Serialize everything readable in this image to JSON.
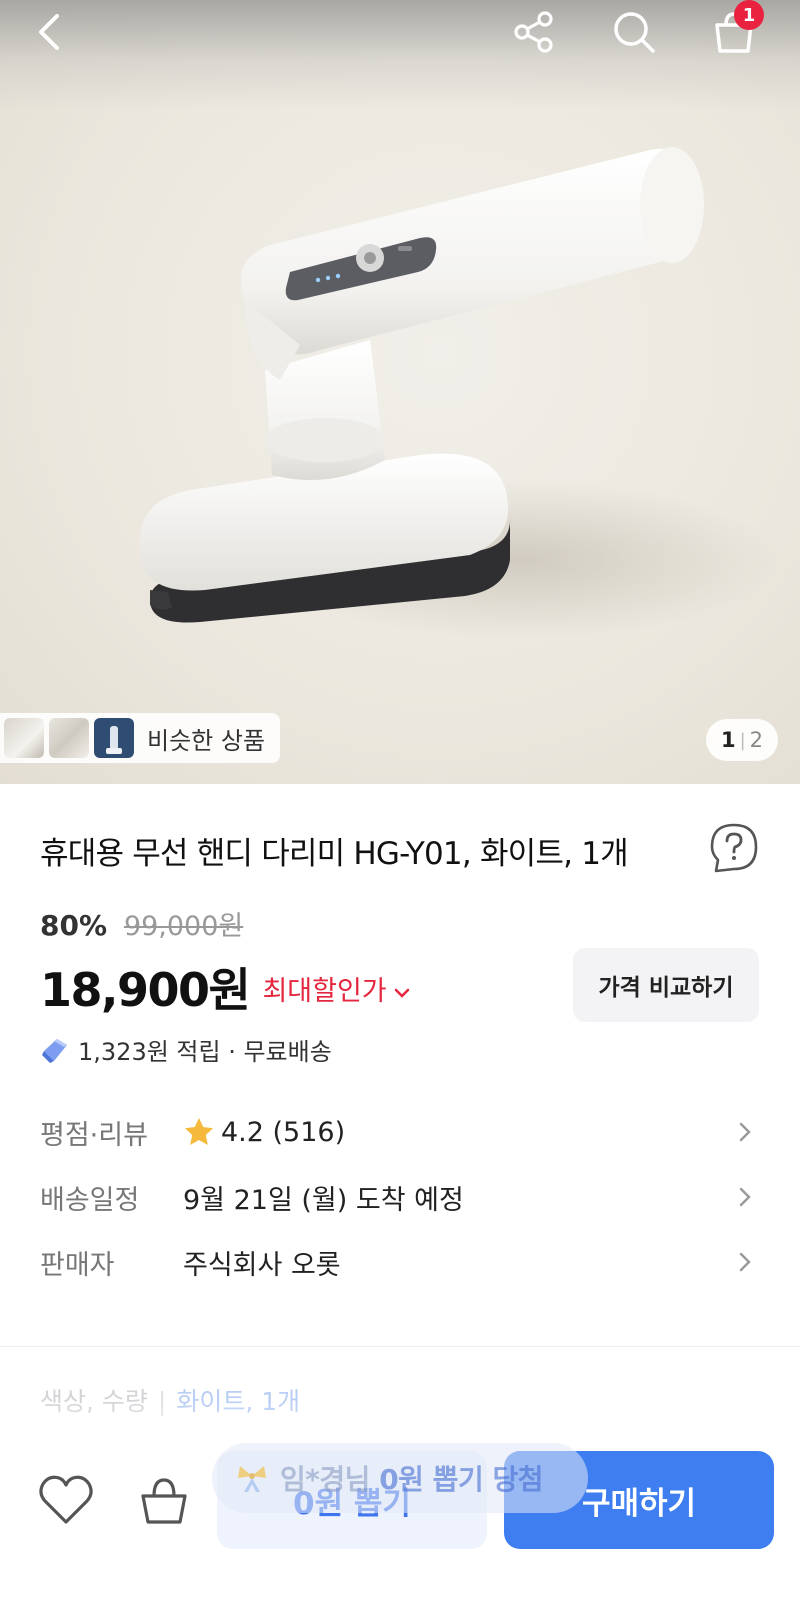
{
  "header": {
    "back_icon": "chevron-left-icon",
    "share_icon": "share-icon",
    "search_icon": "search-icon",
    "cart_icon": "shopping-bag-icon",
    "cart_badge": "1"
  },
  "gallery": {
    "similar_label": "비슷한 상품",
    "page_current": "1",
    "page_total": "2"
  },
  "product": {
    "title": "휴대용 무선 핸디 다리미 HG-Y01, 화이트, 1개",
    "discount_rate": "80%",
    "original_price": "99,000원",
    "sale_price": "18,900원",
    "max_discount_label": "최대할인가",
    "compare_label": "가격 비교하기",
    "reward_text": "1,323원 적립 · 무료배송"
  },
  "info": {
    "rating_label": "평점·리뷰",
    "rating_value": "4.2 (516)",
    "delivery_label": "배송일정",
    "delivery_value": "9월 21일 (월) 도착 예정",
    "seller_label": "판매자",
    "seller_value": "주식회사 오롯"
  },
  "options": {
    "label": "색상, 수량",
    "value": "화이트, 1개"
  },
  "bottom_bar": {
    "zero_draw_label": "0원 뽑기",
    "buy_label": "구매하기",
    "toast_prefix": "임*경님",
    "toast_emph": "0원 뽑기 당첨"
  },
  "colors": {
    "accent": "#3e7ef0",
    "discount_red": "#e5263f",
    "badge_red": "#e8223f",
    "star": "#f5b93b"
  }
}
